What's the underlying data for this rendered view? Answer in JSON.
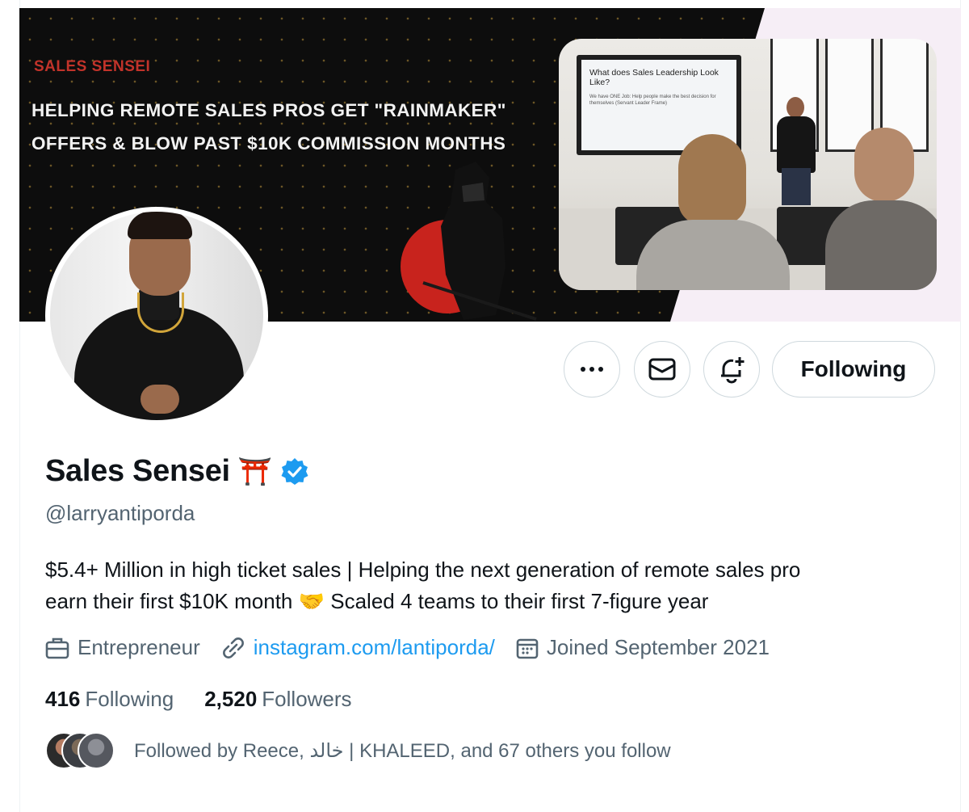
{
  "banner": {
    "kicker": "SALES SENSEI",
    "headline_line1": "HELPING REMOTE SALES PROS GET \"RAINMAKER\"",
    "headline_line2": "OFFERS & BLOW PAST $10K COMMISSION MONTHS",
    "slide_title": "What does Sales Leadership Look Like?",
    "slide_bullet": "We have ONE Job: Help people make the best decision for themselves (Servant Leader Frame)"
  },
  "actions": {
    "more_icon": "more-horizontal-icon",
    "message_icon": "envelope-icon",
    "notify_icon": "bell-plus-icon",
    "follow_label": "Following"
  },
  "profile": {
    "display_name": "Sales Sensei",
    "name_emoji": "⛩️",
    "verified_icon": "verified-badge-icon",
    "handle": "@larryantiporda",
    "bio_line1": "$5.4+ Million in high ticket sales | Helping the next generation of remote sales pro",
    "bio_line2_a": "earn their first $10K month",
    "bio_emoji": "🤝",
    "bio_line2_b": "Scaled 4 teams to their first 7-figure year",
    "category": "Entrepreneur",
    "link": "instagram.com/lantiporda/",
    "joined": "Joined September 2021",
    "following_count": "416",
    "following_label": "Following",
    "followers_count": "2,520",
    "followers_label": "Followers",
    "followed_by": "Followed by Reece, خالد | KHALEED, and 67 others you follow"
  },
  "colors": {
    "accent": "#1d9bf0",
    "muted_text": "#536471",
    "banner_red": "#c2332a"
  }
}
